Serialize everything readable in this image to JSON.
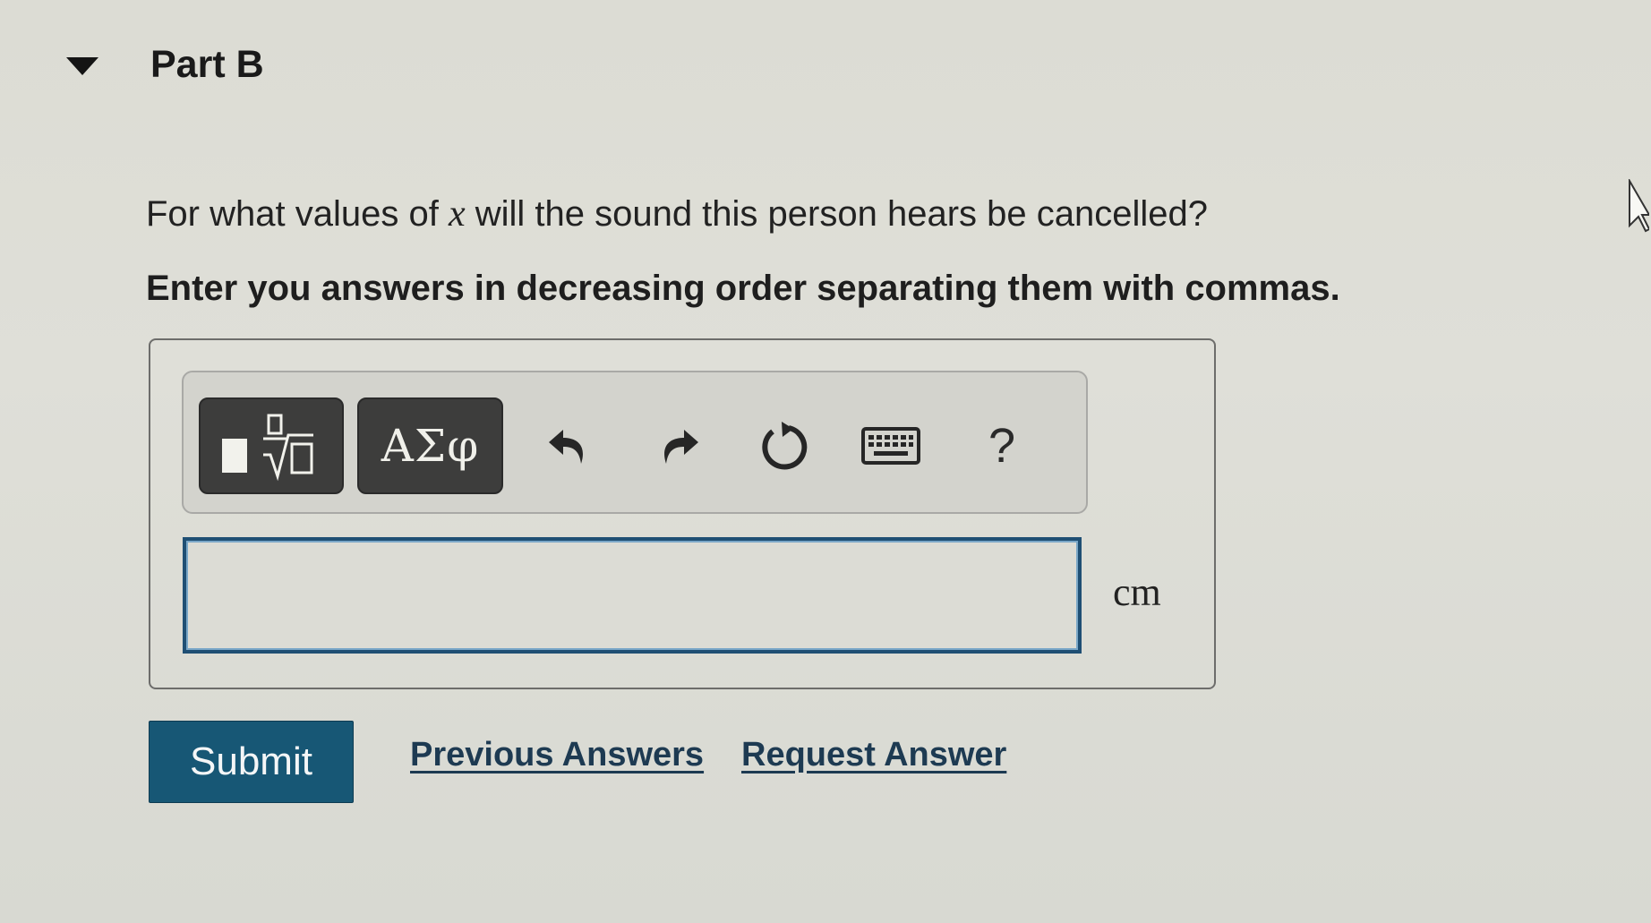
{
  "part": {
    "title": "Part B",
    "toggle_icon": "caret-down-icon"
  },
  "question": {
    "prefix": "For what values of ",
    "variable": "x",
    "suffix": " will the sound this person hears be cancelled?"
  },
  "instruction": "Enter you answers in decreasing order separating them with commas.",
  "toolbar": {
    "buttons": [
      {
        "name": "templates",
        "icon": "fraction-sqrt-template-icon"
      },
      {
        "name": "greek-symbols",
        "label": "ΑΣφ"
      },
      {
        "name": "undo",
        "icon": "undo-arrow-icon"
      },
      {
        "name": "redo",
        "icon": "redo-arrow-icon"
      },
      {
        "name": "reset",
        "icon": "reset-circle-arrow-icon"
      },
      {
        "name": "keyboard",
        "icon": "keyboard-icon"
      },
      {
        "name": "help",
        "label": "?"
      }
    ]
  },
  "answer": {
    "value": "",
    "unit": "cm"
  },
  "actions": {
    "submit_label": "Submit",
    "previous_answers_label": "Previous Answers",
    "request_answer_label": "Request Answer"
  },
  "colors": {
    "submit_bg": "#175775",
    "input_border": "#1f4f74",
    "toolbar_dark": "#3d3d3c"
  }
}
